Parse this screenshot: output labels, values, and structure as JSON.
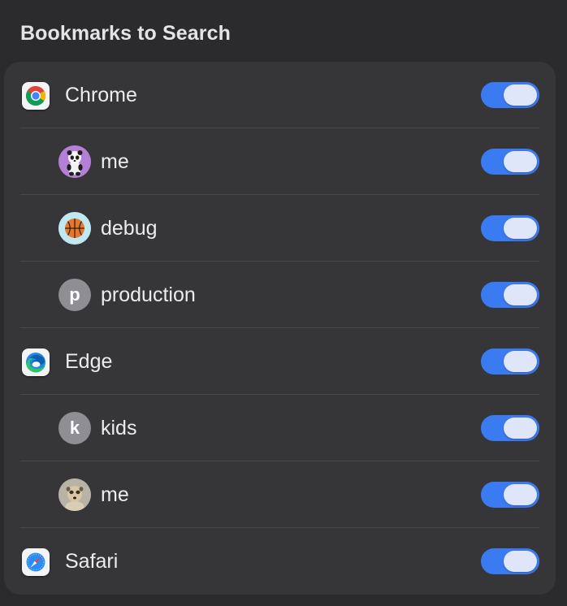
{
  "section": {
    "title": "Bookmarks to Search"
  },
  "colors": {
    "background": "#2b2b2d",
    "panel": "#363638",
    "toggle_on": "#3b7bf2",
    "toggle_knob": "#dfe6fa",
    "letter_avatar": "#8e8e93"
  },
  "rows": [
    {
      "label": "Chrome",
      "level": 0,
      "icon": "chrome-icon",
      "enabled": true
    },
    {
      "label": "me",
      "level": 1,
      "icon": "panda-avatar-icon",
      "enabled": true
    },
    {
      "label": "debug",
      "level": 1,
      "icon": "basketball-avatar-icon",
      "enabled": true
    },
    {
      "label": "production",
      "level": 1,
      "icon": "letter-avatar",
      "avatar_letter": "p",
      "enabled": true
    },
    {
      "label": "Edge",
      "level": 0,
      "icon": "edge-icon",
      "enabled": true
    },
    {
      "label": "kids",
      "level": 1,
      "icon": "letter-avatar",
      "avatar_letter": "k",
      "enabled": true
    },
    {
      "label": "me",
      "level": 1,
      "icon": "meerkat-avatar-icon",
      "enabled": true
    },
    {
      "label": "Safari",
      "level": 0,
      "icon": "safari-icon",
      "enabled": true
    }
  ]
}
